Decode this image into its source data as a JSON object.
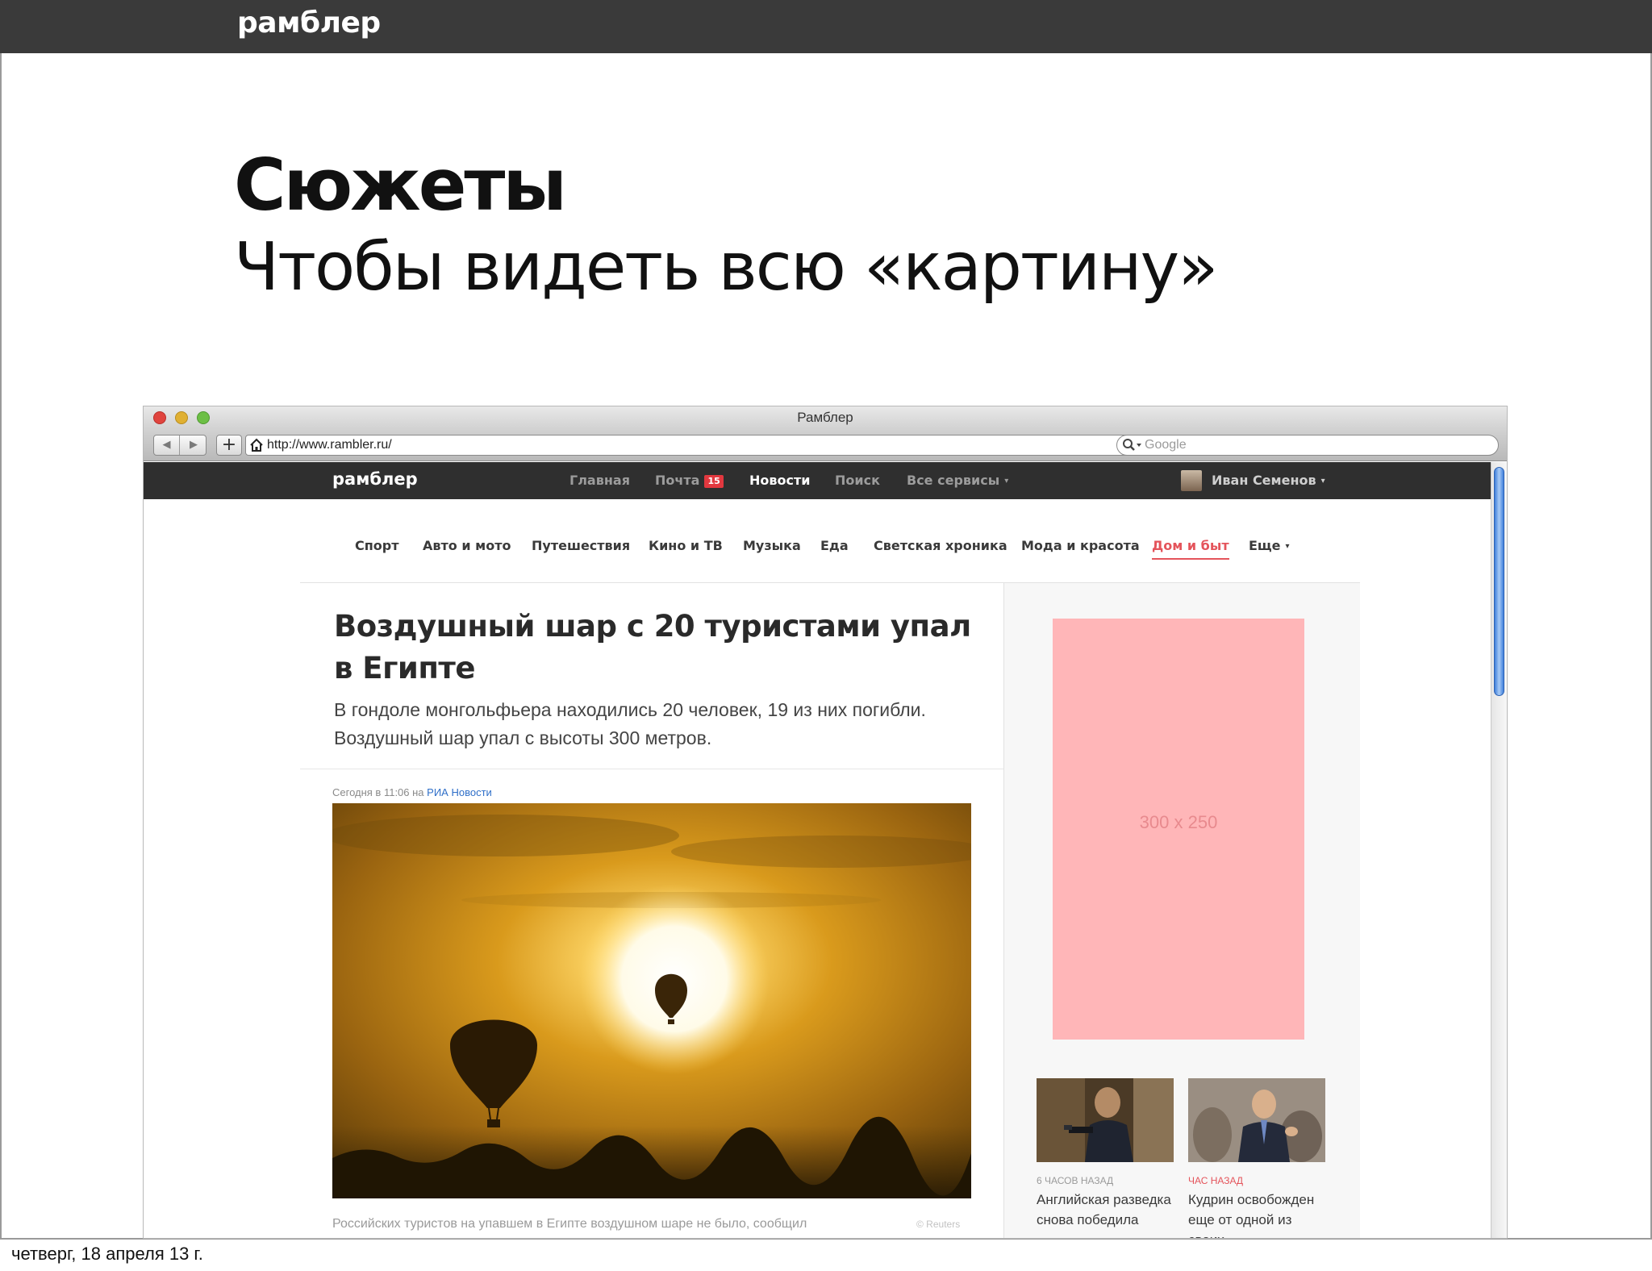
{
  "slide": {
    "logo": "рамблер",
    "title": "Сюжеты",
    "subtitle": "Чтобы видеть всю «картину»",
    "footer_date": "четверг, 18 апреля 13 г."
  },
  "browser": {
    "window_title": "Рамблер",
    "url": "http://www.rambler.ru/",
    "search_placeholder": "Google",
    "back_glyph": "◀",
    "forward_glyph": "▶",
    "add_glyph": "+",
    "reload_glyph": "↻"
  },
  "site": {
    "logo": "рамблер",
    "nav": {
      "home": "Главная",
      "mail": "Почта",
      "mail_count": "15",
      "news": "Новости",
      "search": "Поиск",
      "services": "Все сервисы"
    },
    "user_name": "Иван Семенов",
    "categories": {
      "sport": "Спорт",
      "auto": "Авто и мото",
      "travel": "Путешествия",
      "movies": "Кино и ТВ",
      "music": "Музыка",
      "food": "Еда",
      "celebrity": "Светская хроника",
      "fashion": "Мода и красота",
      "home": "Дом и быт",
      "more": "Еще"
    },
    "active_category": "Дом и быт"
  },
  "article": {
    "headline": "Воздушный шар с 20 туристами упал в Египте",
    "lead": "В гондоле монгольфьера находились 20 человек, 19 из них погибли. Воздушный шар упал с высоты 300 метров.",
    "meta_prefix": "Сегодня в 11:06 на",
    "source": "РИА Новости",
    "caption": "Российских туристов на упавшем в Египте воздушном шаре не было, сообщил",
    "photo_credit": "© Reuters"
  },
  "sidebar": {
    "ad_label": "300 x 250",
    "cards": [
      {
        "time": "6 часов назад",
        "title": "Английская разведка снова победила"
      },
      {
        "time": "час назад",
        "title": "Кудрин освобожден еще от одной из своих"
      }
    ]
  },
  "colors": {
    "slide_bar": "#3a3a3a",
    "site_header": "#2f2f2f",
    "accent_red": "#e4545b",
    "ad_pink": "#ffb6b8",
    "link_blue": "#2f6fc8"
  }
}
